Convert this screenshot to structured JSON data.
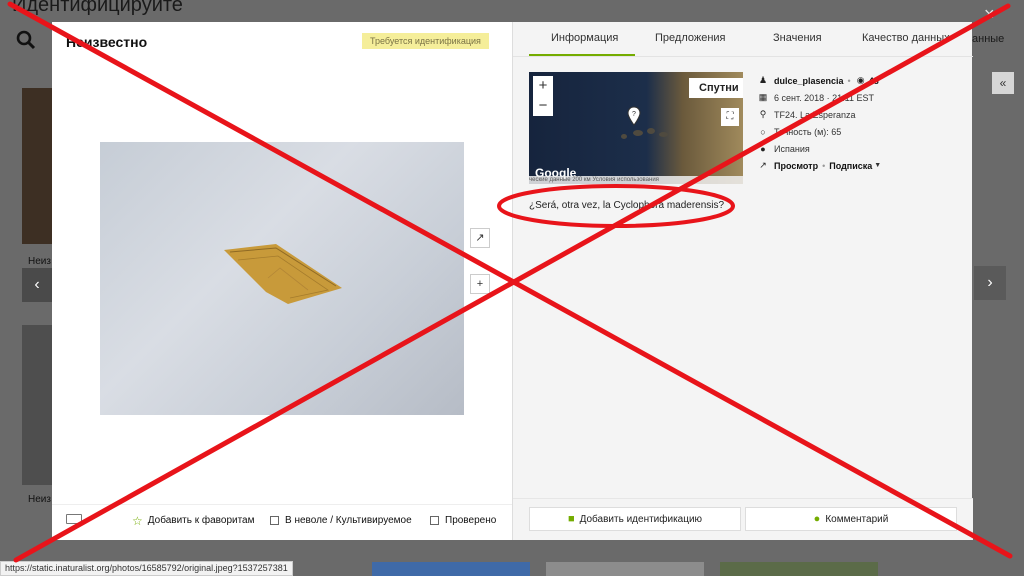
{
  "background": {
    "title": "Идентифицируйте",
    "right_word": "анные",
    "close_glyph": "×",
    "caption_1": "Неиз",
    "caption_2": "Неиз",
    "arrow_left": "‹",
    "arrow_right": "›",
    "collapse_glyph": "«"
  },
  "left": {
    "title": "Неизвестно",
    "badge": "Требуется идентификация",
    "tool_external": "↗",
    "tool_plus": "+",
    "favorite_label": "Добавить к фаворитам",
    "captive_label": "В неволе / Культивируемое",
    "reviewed_label": "Проверено"
  },
  "tabs": [
    {
      "label": "Информация"
    },
    {
      "label": "Предложения"
    },
    {
      "label": "Значения"
    },
    {
      "label": "Качество данных"
    }
  ],
  "map": {
    "zoom_in": "+",
    "zoom_out": "−",
    "type_label": "Спутни",
    "logo": "Google",
    "terms": "ческие данные   200 км         Условия использования"
  },
  "details": {
    "user": "dulce_plasencia",
    "observations": "48",
    "date": "6 сент. 2018 · 21:11 EST",
    "place": "TF24. La Esperanza",
    "accuracy": "Точность (м): 65",
    "country": "Испания",
    "view_label": "Просмотр",
    "subscribe_label": "Подписка"
  },
  "description": "¿Será, otra vez, la Cyclophora maderensis?",
  "actions": {
    "add_id": "Добавить идентификацию",
    "comment": "Комментарий"
  },
  "status_url": "https://static.inaturalist.org/photos/16585792/original.jpeg?1537257381",
  "colors": {
    "accent": "#74ac00",
    "overlay_red": "#e8141a",
    "badge_bg": "#f5ee9a"
  }
}
